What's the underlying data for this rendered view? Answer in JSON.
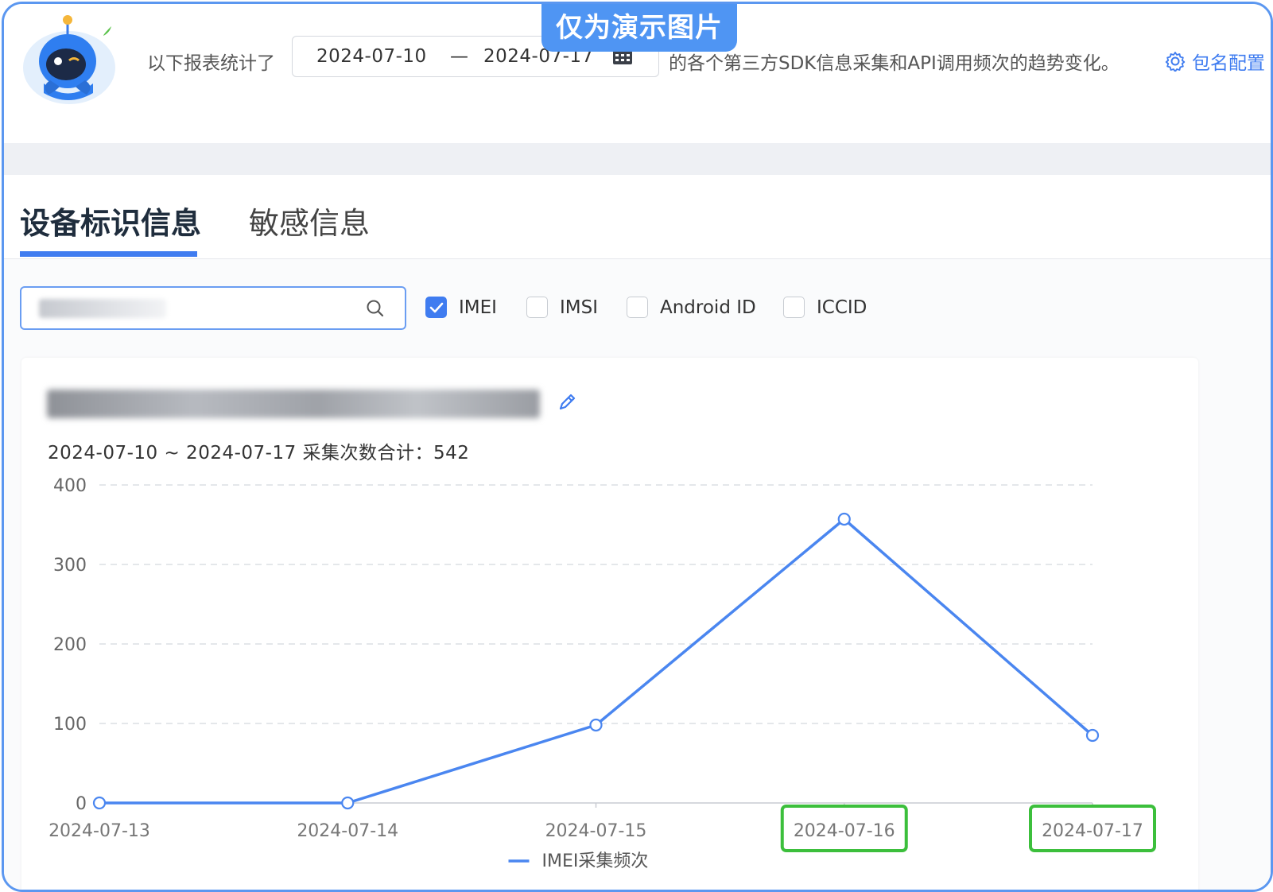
{
  "banner": "仅为演示图片",
  "header": {
    "prefix": "以下报表统计了",
    "date_start": "2024-07-10",
    "date_sep": "—",
    "date_end": "2024-07-17",
    "suffix": "的各个第三方SDK信息采集和API调用频次的趋势变化。",
    "pkg_config_label": "包名配置",
    "pkg_config_icon": "gear-icon",
    "calendar_icon": "calendar-icon"
  },
  "tabs": [
    {
      "label": "设备标识信息",
      "active": true
    },
    {
      "label": "敏感信息",
      "active": false
    }
  ],
  "filters": {
    "search_icon": "search-icon",
    "checkboxes": [
      {
        "label": "IMEI",
        "checked": true
      },
      {
        "label": "IMSI",
        "checked": false
      },
      {
        "label": "Android ID",
        "checked": false
      },
      {
        "label": "ICCID",
        "checked": false
      }
    ]
  },
  "card": {
    "edit_icon": "pencil-icon",
    "summary": "2024-07-10 ~ 2024-07-17 采集次数合计：542"
  },
  "colors": {
    "accent": "#3f7cf0",
    "series": "#4a86f0",
    "highlight_box": "#3cbf3c",
    "banner_bg": "#4f95f3"
  },
  "chart_data": {
    "type": "line",
    "categories": [
      "2024-07-13",
      "2024-07-14",
      "2024-07-15",
      "2024-07-16",
      "2024-07-17"
    ],
    "series": [
      {
        "name": "IMEI采集频次",
        "values": [
          0,
          0,
          98,
          357,
          85
        ]
      }
    ],
    "y_ticks": [
      0,
      100,
      200,
      300,
      400
    ],
    "ylim": [
      0,
      400
    ],
    "grid": true,
    "legend_position": "bottom-center",
    "highlighted_categories": [
      "2024-07-16",
      "2024-07-17"
    ]
  }
}
